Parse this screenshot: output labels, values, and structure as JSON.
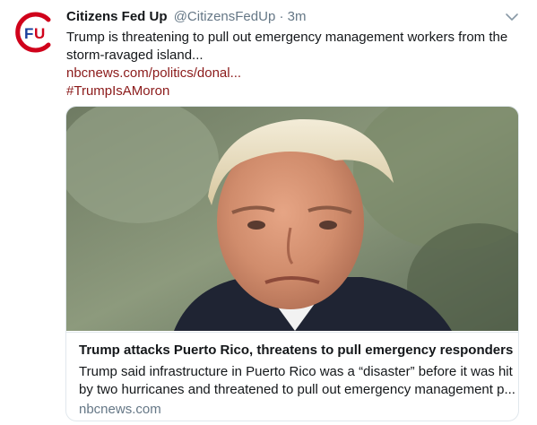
{
  "author": {
    "display_name": "Citizens Fed Up",
    "handle": "@CitizensFedUp",
    "separator": "·",
    "time": "3m",
    "avatar_text": "FU",
    "avatar_colors": {
      "ring": "#d0021b",
      "letter_f": "#1a3f9c",
      "letter_u": "#d0021b"
    }
  },
  "tweet": {
    "text_line1": "Trump is threatening to pull out emergency management workers from the",
    "text_line2": "storm-ravaged island...",
    "link": "nbcnews.com/politics/donal...",
    "hashtag": "#TrumpIsAMoron",
    "link_color": "#8b1a1a"
  },
  "card": {
    "image_icon": "news-photo",
    "title": "Trump attacks Puerto Rico, threatens to pull emergency responders",
    "description_line1": "Trump said infrastructure in Puerto Rico was a “disaster” before it was hit",
    "description_line2": "by two hurricanes and threatened to pull out emergency management p...",
    "domain": "nbcnews.com"
  },
  "icons": {
    "menu": "chevron-down-icon",
    "avatar": "avatar"
  }
}
